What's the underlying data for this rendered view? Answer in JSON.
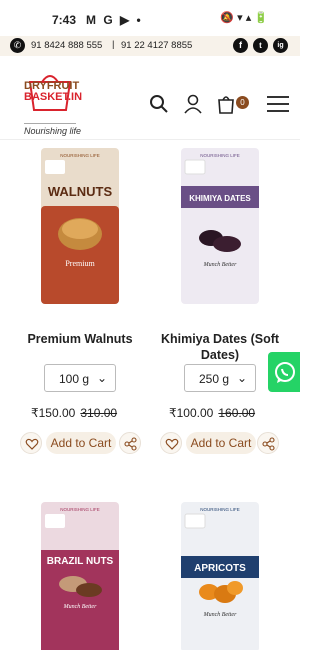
{
  "status_bar": {
    "time": "7:43",
    "left_icons": "M G ▶ •",
    "right_icons": "🔕 ▾ ▴ 🔋"
  },
  "contact": {
    "phone1": "91 8424 888 555",
    "separator": "|",
    "phone2": "91 22 4127 8855",
    "social": [
      "f",
      "t",
      "ig"
    ]
  },
  "header": {
    "logo_line1": "DRYFRUIT",
    "logo_line2": "BASKET.IN",
    "tagline": "Nourishing life",
    "cart_count": "0"
  },
  "products": [
    {
      "name": "Premium Walnuts",
      "pack_title": "WALNUTS",
      "pack_sub": "Premium",
      "weight": "100 g",
      "price": "₹150.00",
      "old_price": "310.00",
      "add_to_cart": "Add to Cart",
      "pack_color": "#b84a2c",
      "band_color": "#e9dccb"
    },
    {
      "name": "Khimiya Dates (Soft Dates)",
      "pack_title": "KHIMIYA DATES",
      "pack_sub": "Munch Better",
      "weight": "250 g",
      "price": "₹100.00",
      "old_price": "160.00",
      "add_to_cart": "Add to Cart",
      "pack_color": "#eeeaf2",
      "band_color": "#6a4f86"
    },
    {
      "name": "",
      "pack_title": "BRAZIL NUTS",
      "pack_sub": "Munch Better",
      "pack_color": "#a2345c",
      "band_color": "#ecd9e0"
    },
    {
      "name": "",
      "pack_title": "APRICOTS",
      "pack_sub": "Munch Better",
      "pack_color": "#eef0f4",
      "band_color": "#1f3f6e"
    }
  ],
  "pack_brand": "DRYFRUIT BASKET.IN",
  "pack_top_text": "NOURISHING LIFE"
}
